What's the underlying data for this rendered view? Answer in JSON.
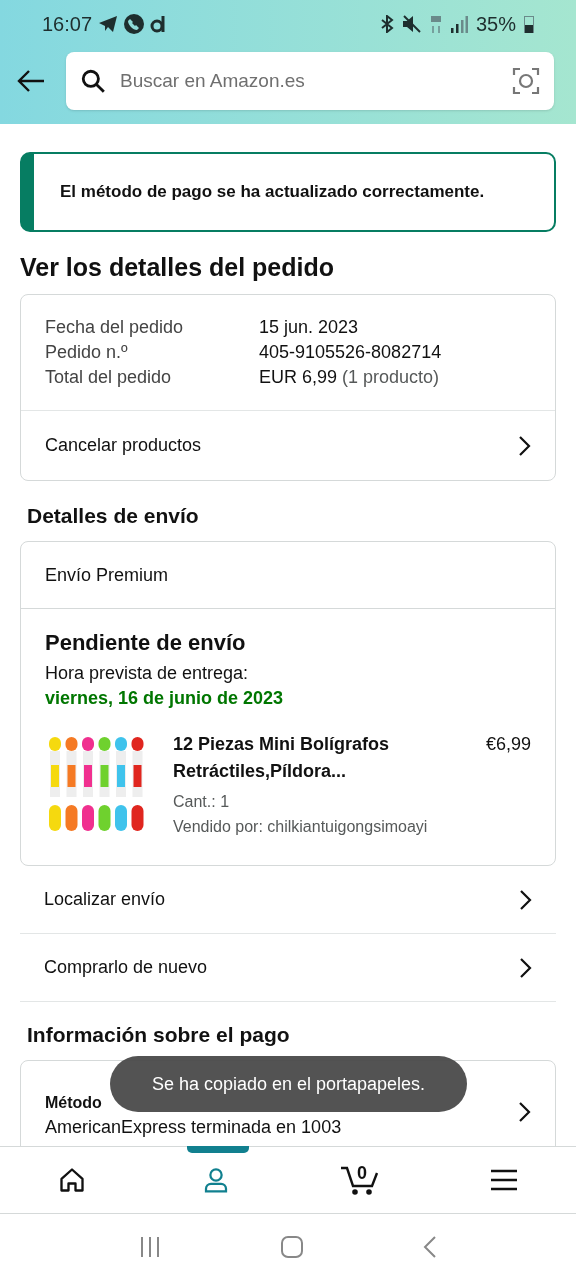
{
  "status_bar": {
    "time": "16:07",
    "battery": "35%"
  },
  "search": {
    "placeholder": "Buscar en Amazon.es"
  },
  "banner": "El método de pago se ha actualizado correctamente.",
  "title": "Ver los detalles del pedido",
  "order": {
    "rows": [
      {
        "label": "Fecha del pedido",
        "value": "15 jun. 2023"
      },
      {
        "label": "Pedido n.º",
        "value": "405-9105526-8082714"
      },
      {
        "label": "Total del pedido",
        "value": "EUR 6,99",
        "note": "(1 producto)"
      }
    ],
    "action": "Cancelar productos"
  },
  "shipping": {
    "heading": "Detalles de envío",
    "method": "Envío Premium",
    "status": "Pendiente de envío",
    "eta_label": "Hora prevista de entrega:",
    "eta": "viernes, 16 de junio de 2023",
    "product": {
      "kind": "picture",
      "title": "12 Piezas Mini Bolígrafos Retráctiles,Píldora...",
      "price": "€6,99",
      "qty": "Cant.: 1",
      "seller": "Vendido por: chilkiantuigongsimoayi"
    },
    "actions": [
      "Localizar envío",
      "Comprarlo de nuevo"
    ]
  },
  "payment": {
    "heading": "Información sobre el pago",
    "label": "Método",
    "value": "AmericanExpress terminada en 1003"
  },
  "toast": "Se ha copiado en el portapapeles.",
  "nav": [
    {
      "kind": "home",
      "selected": false
    },
    {
      "kind": "account",
      "selected": true
    },
    {
      "kind": "cart",
      "selected": false,
      "count": "0"
    },
    {
      "kind": "menu",
      "selected": false
    }
  ]
}
